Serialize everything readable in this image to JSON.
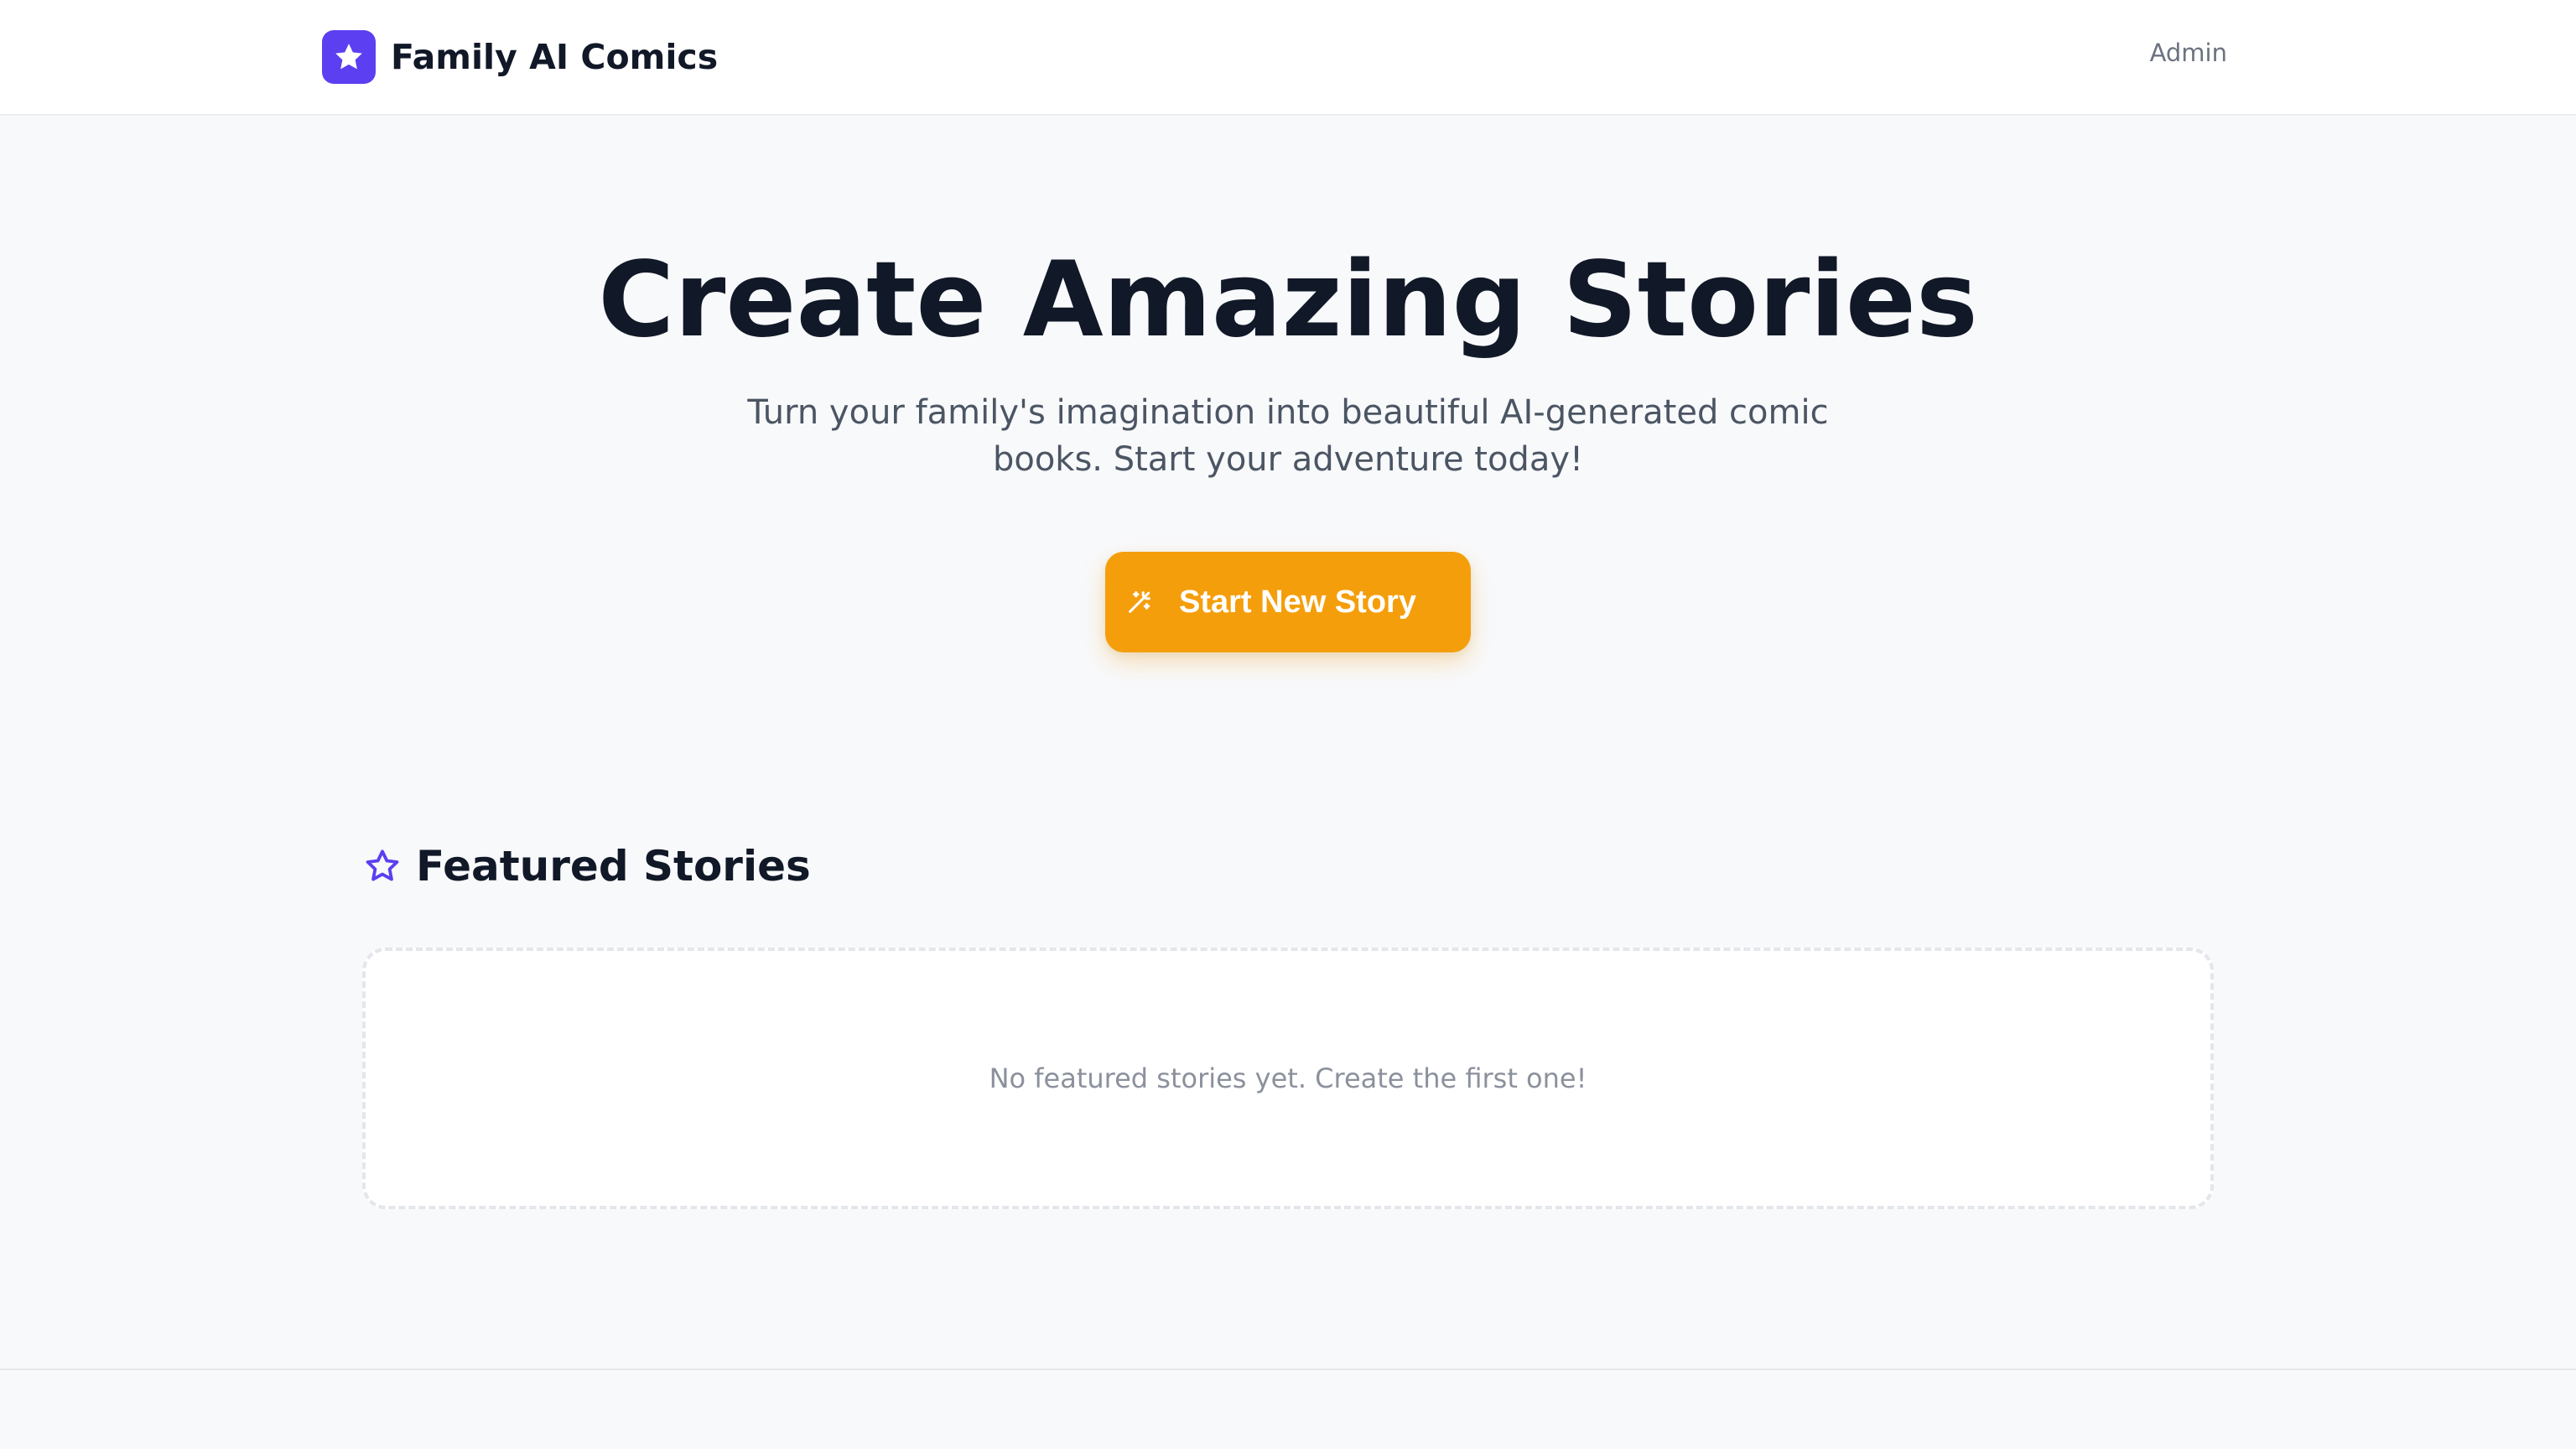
{
  "header": {
    "brand_name": "Family AI Comics",
    "brand_icon": "star-icon",
    "admin_label": "Admin"
  },
  "hero": {
    "title": "Create Amazing Stories",
    "subtitle": "Turn your family's imagination into beautiful AI-generated comic books. Start your adventure today!",
    "cta_label": "Start New Story",
    "cta_icon": "magic-wand-icon"
  },
  "featured": {
    "title": "Featured Stories",
    "icon": "star-outline-icon",
    "empty_message": "No featured stories yet. Create the first one!"
  },
  "colors": {
    "brand": "#5b3ff0",
    "accent": "#f59e0b",
    "heading": "#111827",
    "muted": "#6b7280",
    "background": "#f8f9fb"
  }
}
